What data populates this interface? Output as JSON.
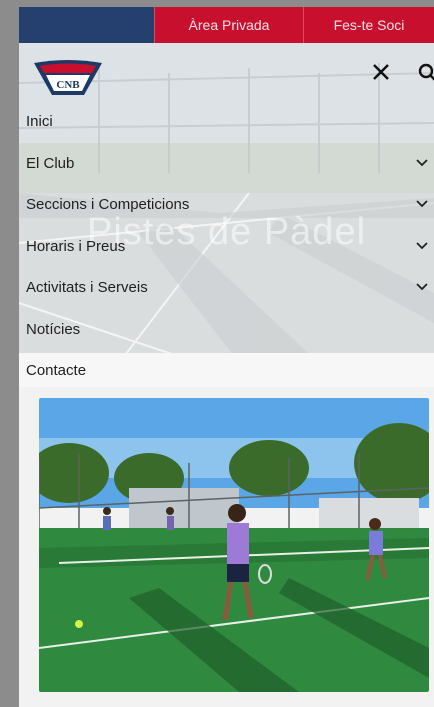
{
  "topbar": {
    "area_privada": "Àrea Privada",
    "fes_te_soci": "Fes-te Soci"
  },
  "header": {
    "logo_text": "CNB",
    "hero_title": "Pistes de Pàdel"
  },
  "menu": {
    "items": [
      {
        "label": "Inici",
        "has_submenu": false
      },
      {
        "label": "El Club",
        "has_submenu": true
      },
      {
        "label": "Seccions i Competicions",
        "has_submenu": true
      },
      {
        "label": "Horaris i Preus",
        "has_submenu": true
      },
      {
        "label": "Activitats i Serveis",
        "has_submenu": true
      },
      {
        "label": "Notícies",
        "has_submenu": false
      }
    ],
    "contact": "Contacte"
  },
  "icons": {
    "close": "close-icon",
    "search": "search-icon",
    "chevron": "chevron-down-icon"
  },
  "colors": {
    "navy": "#25406e",
    "red": "#c8102e"
  }
}
